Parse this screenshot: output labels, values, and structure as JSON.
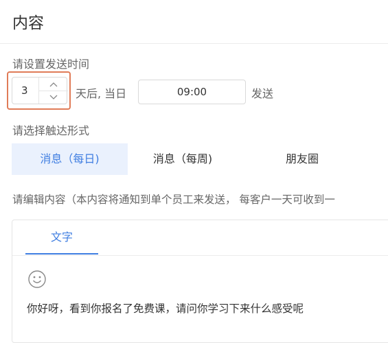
{
  "page": {
    "title": "内容"
  },
  "send_time": {
    "label": "请设置发送时间",
    "days_value": "3",
    "after_label": "天后, 当日",
    "time_value": "09:00",
    "send_label": "发送"
  },
  "reach_type": {
    "label": "请选择触达形式",
    "options": [
      "消息（每日)",
      "消息（每周)",
      "朋友圈"
    ],
    "selected": "消息（每日)"
  },
  "edit": {
    "label": "请编辑内容（本内容将通知到单个员工来发送， 每客户一天可收到一",
    "tab": "文字",
    "message": "你好呀，看到你报名了免费课，请问你学习下来什么感受呢"
  },
  "colors": {
    "accent": "#3e7de1",
    "highlight": "#e07b57",
    "selected_bg": "#eaf1fd"
  },
  "icons": {
    "up": "chevron-up-icon",
    "down": "chevron-down-icon",
    "emoji": "smiley-icon"
  }
}
